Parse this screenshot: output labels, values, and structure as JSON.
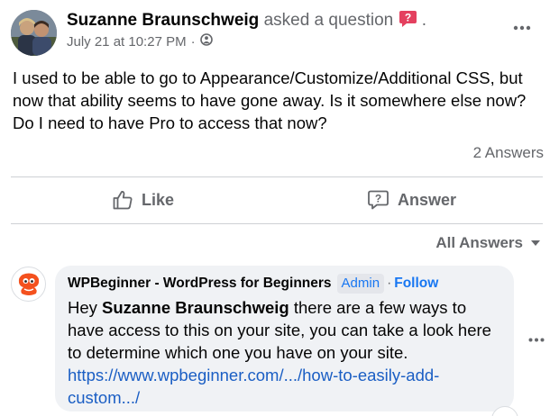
{
  "post": {
    "author": "Suzanne Braunschweig",
    "action": "asked a question",
    "trailing_dot": ".",
    "timestamp": "July 21 at 10:27 PM",
    "meta_sep": "·",
    "body": "I used to be able to go to Appearance/Customize/Additional CSS, but now that ability seems to have gone away.  Is it somewhere else now? Do I need to have Pro to access that now?",
    "answers_count": "2 Answers"
  },
  "actions": {
    "like": "Like",
    "answer": "Answer"
  },
  "filter": {
    "label": "All Answers"
  },
  "reply": {
    "page_name": "WPBeginner - WordPress for Beginners",
    "badge": "Admin",
    "sep": "·",
    "follow": "Follow",
    "text_prefix": "Hey ",
    "mention": "Suzanne Braunschweig",
    "text_suffix": " there are a few ways to have access to this on your site, you can take a look here to determine which one you have on your site.",
    "link": "https://www.wpbeginner.com/.../how-to-easily-add-custom.../"
  },
  "icons": {
    "question_badge": "question-bubble-icon",
    "privacy": "members-globe-icon",
    "more": "more-horizontal-icon",
    "like": "thumbs-up-icon",
    "answer": "question-speech-icon",
    "dropdown": "caret-down-icon"
  },
  "colors": {
    "accent": "#1877f2",
    "link": "#1a5ec4",
    "secondary_text": "#65676b",
    "bubble_bg": "#f0f2f5",
    "question_badge": "#e4405f",
    "brand_logo": "#f4511e"
  }
}
